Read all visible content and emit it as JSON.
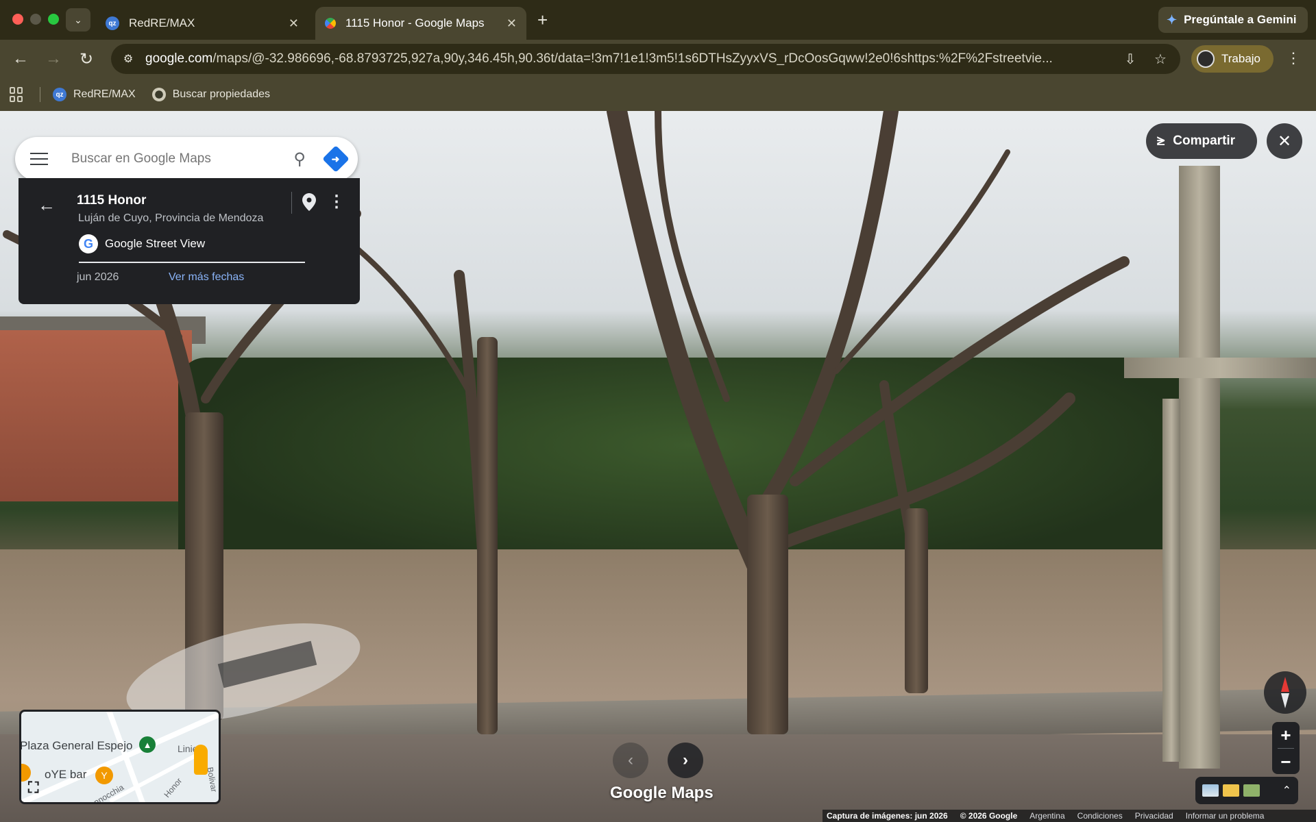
{
  "browser": {
    "tabs": [
      {
        "title": "RedRE/MAX",
        "active": false,
        "favicon": "remax-icon"
      },
      {
        "title": "1115 Honor - Google Maps",
        "active": true,
        "favicon": "google-maps-icon"
      }
    ],
    "new_tab_symbol": "+",
    "gemini_label": "Pregúntale a Gemini",
    "url_host": "google.com",
    "url_rest": "/maps/@-32.986696,-68.8793725,927a,90y,346.45h,90.36t/data=!3m7!1e1!3m5!1s6DTHsZyyxVS_rDcOosGqww!2e0!6shttps:%2F%2Fstreetvie...",
    "profile_label": "Trabajo",
    "bookmarks": [
      {
        "label": "RedRE/MAX",
        "icon": "remax-icon"
      },
      {
        "label": "Buscar propiedades",
        "icon": "globe-icon"
      }
    ]
  },
  "maps": {
    "search_placeholder": "Buscar en Google Maps",
    "place": {
      "title": "1115 Honor",
      "subtitle": "Luján de Cuyo, Provincia de Mendoza",
      "source": "Google Street View",
      "date": "jun 2026",
      "more_dates": "Ver más fechas"
    },
    "share_label": "Compartir",
    "logo_text": "Google Maps",
    "minimap": {
      "labels": [
        "Plaza General Espejo",
        "Linier",
        "oYE bar",
        "Pannocchia",
        "Honor",
        "Bolivar"
      ]
    },
    "zoom": {
      "in": "+",
      "out": "−"
    },
    "footer": [
      "Captura de imágenes: jun 2026",
      "© 2026 Google",
      "Argentina",
      "Condiciones",
      "Privacidad",
      "Informar un problema"
    ]
  },
  "colors": {
    "chrome_bg": "#2e2b17",
    "toolbar_bg": "#4a4630",
    "profile_accent": "#7a6a30",
    "maps_panel": "#202124",
    "link_blue": "#8ab4f8",
    "compass_north": "#e53935"
  }
}
